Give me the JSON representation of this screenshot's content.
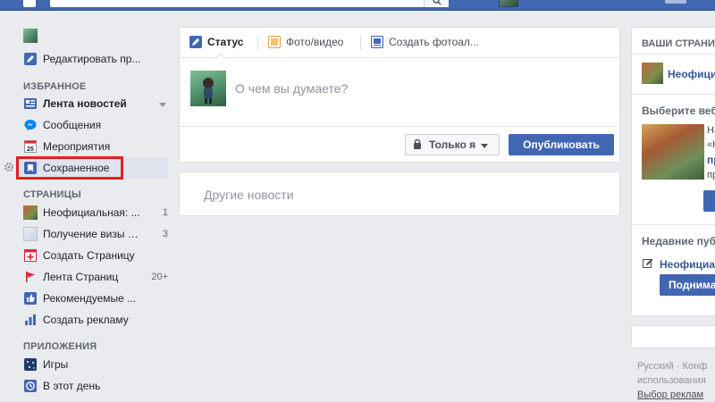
{
  "sidebar": {
    "profile": {
      "label": "Редактировать пр..."
    },
    "favorites_heading": "ИЗБРАННОЕ",
    "favorites": [
      {
        "label": "Лента новостей",
        "icon": "news-feed-icon"
      },
      {
        "label": "Сообщения",
        "icon": "messages-icon"
      },
      {
        "label": "Мероприятия",
        "icon": "calendar-icon",
        "icon_text": "25"
      },
      {
        "label": "Сохраненное",
        "icon": "bookmark-icon"
      }
    ],
    "pages_heading": "СТРАНИЦЫ",
    "pages": [
      {
        "label": "Неофициальная: ...",
        "count": "1"
      },
      {
        "label": "Получение визы С...",
        "count": "3"
      },
      {
        "label": "Создать Страницу",
        "count": ""
      },
      {
        "label": "Лента Страниц",
        "count": "20+"
      },
      {
        "label": "Рекомендуемые ...",
        "count": ""
      },
      {
        "label": "Создать рекламу",
        "count": ""
      }
    ],
    "apps_heading": "ПРИЛОЖЕНИЯ",
    "apps": [
      {
        "label": "Игры"
      },
      {
        "label": "В этот день"
      }
    ]
  },
  "composer": {
    "tabs": [
      "Статус",
      "Фото/видео",
      "Создать фотоал..."
    ],
    "placeholder": "О чем вы думаете?",
    "privacy_label": "Только я",
    "publish_label": "Опубликовать"
  },
  "feed": {
    "other_news": "Другие новости"
  },
  "right": {
    "pages_heading": "ВАШИ СТРАНИ",
    "page_name": "Неофици",
    "promo_heading": "Выберите веб",
    "promo_line1": "На",
    "promo_line2": "«Н",
    "promo_line3": "пр",
    "promo_line4": "пр",
    "recent_heading": "Недавние пуб",
    "recent_page": "Неофициа",
    "raise_button": "Поднима",
    "footer_line1": "Русский · Конф",
    "footer_line2": "использования",
    "footer_line3": "Выбор реклам"
  },
  "colors": {
    "brand": "#4267b2",
    "highlight_box": "#e02020",
    "link": "#365899"
  }
}
